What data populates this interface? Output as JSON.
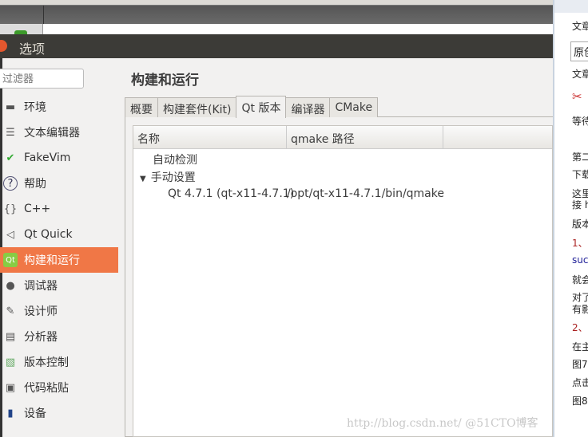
{
  "window": {
    "title": "选项"
  },
  "filter": {
    "placeholder": "过滤器"
  },
  "sidebar": {
    "items": [
      {
        "label": "环境",
        "icon": "monitor-icon"
      },
      {
        "label": "文本编辑器",
        "icon": "text-editor-icon"
      },
      {
        "label": "FakeVim",
        "icon": "fakevim-icon"
      },
      {
        "label": "帮助",
        "icon": "help-icon"
      },
      {
        "label": "C++",
        "icon": "braces-icon"
      },
      {
        "label": "Qt Quick",
        "icon": "qt-quick-icon"
      },
      {
        "label": "构建和运行",
        "icon": "qt-icon",
        "selected": true
      },
      {
        "label": "调试器",
        "icon": "debugger-icon"
      },
      {
        "label": "设计师",
        "icon": "designer-icon"
      },
      {
        "label": "分析器",
        "icon": "analyzer-icon"
      },
      {
        "label": "版本控制",
        "icon": "version-control-icon"
      },
      {
        "label": "代码粘贴",
        "icon": "code-paste-icon"
      },
      {
        "label": "设备",
        "icon": "device-icon"
      }
    ]
  },
  "main": {
    "heading": "构建和运行",
    "tabs": [
      "概要",
      "构建套件(Kit)",
      "Qt 版本",
      "编译器",
      "CMake"
    ],
    "columns": [
      "名称",
      "qmake 路径"
    ],
    "rows": {
      "auto": "自动检测",
      "manual": "手动设置",
      "qt_name": "Qt 4.7.1 (qt-x11-4.7.1)",
      "qt_path": "/opt/qt-x11-4.7.1/bin/qmake"
    }
  },
  "right_panel": {
    "lines": [
      "文章",
      "原创",
      "文章",
      "等待",
      "第二",
      "下载",
      "这里",
      "接 h",
      "版本",
      "1、",
      "suc",
      "就会",
      "对了",
      "有影",
      "2、",
      "在主",
      "图7",
      "点击",
      "图8"
    ]
  },
  "watermark": "http://blog.csdn.net/  @51CTO博客",
  "colors": {
    "accent": "#f07746"
  }
}
